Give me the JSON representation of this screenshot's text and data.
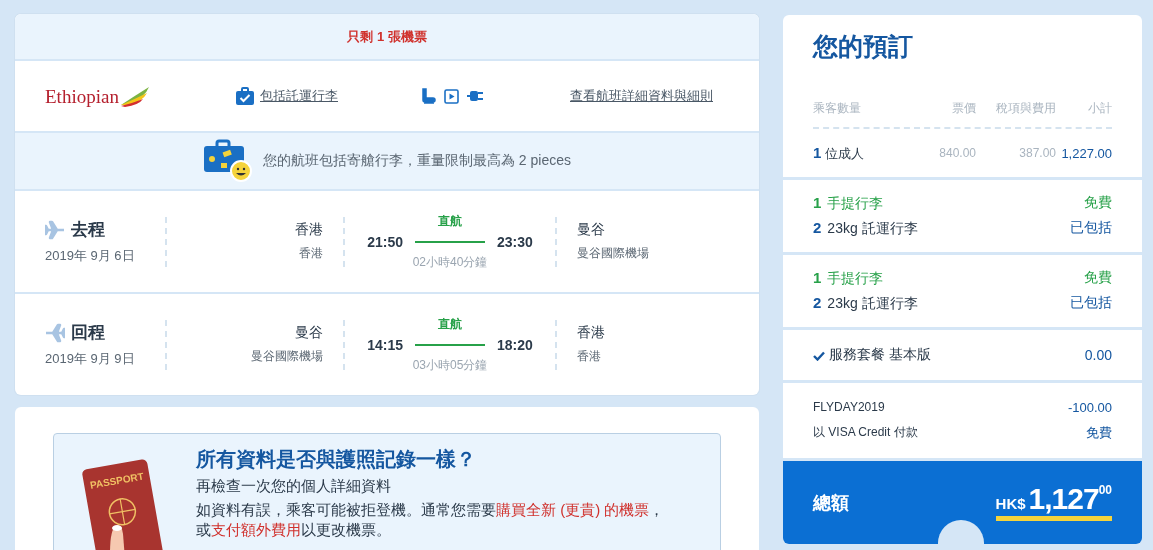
{
  "flight": {
    "notice": "只剩 1 張機票",
    "airline": {
      "name": "Ethiopian"
    },
    "baggage_link": "包括託運行李",
    "details_link": "查看航班詳細資料與細則",
    "baggage_note": "您的航班包括寄艙行李，重量限制最高為 2 pieces",
    "legs": [
      {
        "kind": "outbound",
        "label": "去程",
        "date": "2019年 9月 6日",
        "from_city": "香港",
        "from_airport": "香港",
        "depart": "21:50",
        "stops": "直航",
        "arrive": "23:30",
        "duration": "02小時40分鐘",
        "to_city": "曼谷",
        "to_airport": "曼谷國際機場"
      },
      {
        "kind": "return",
        "label": "回程",
        "date": "2019年 9月 9日",
        "from_city": "曼谷",
        "from_airport": "曼谷國際機場",
        "depart": "14:15",
        "stops": "直航",
        "arrive": "18:20",
        "duration": "03小時05分鐘",
        "to_city": "香港",
        "to_airport": "香港"
      }
    ]
  },
  "passport_check": {
    "passport_label": "PASSPORT",
    "title": "所有資料是否與護照記錄一樣？",
    "subtitle": "再檢查一次您的個人詳細資料",
    "body": [
      {
        "kind": "plain",
        "text": "如資料有誤，乘客可能被拒登機。通常您需要"
      },
      {
        "kind": "link",
        "text": "購買全新 (更貴) 的機票"
      },
      {
        "kind": "plain",
        "text": "，或"
      },
      {
        "kind": "link",
        "text": "支付額外費用"
      },
      {
        "kind": "plain",
        "text": "以更改機票。"
      }
    ]
  },
  "summary": {
    "title": "您的預訂",
    "columns": [
      "乘客數量",
      "票價",
      "稅項與費用",
      "小計"
    ],
    "passenger": {
      "count": "1",
      "label": "位成人",
      "fare": "840.00",
      "taxes": "387.00",
      "subtotal": "1,227.00"
    },
    "baggage_groups": [
      {
        "items": [
          {
            "kind": "carry_on",
            "count": "1",
            "label": "手提行李",
            "value": "免費"
          },
          {
            "kind": "checked",
            "count": "2",
            "label": "23kg 託運行李",
            "value": "已包括"
          }
        ]
      },
      {
        "items": [
          {
            "kind": "carry_on",
            "count": "1",
            "label": "手提行李",
            "value": "免費"
          },
          {
            "kind": "checked",
            "count": "2",
            "label": "23kg 託運行李",
            "value": "已包括"
          }
        ]
      }
    ],
    "service": {
      "label": "服務套餐 基本版",
      "value": "0.00"
    },
    "promo": {
      "code": "FLYDAY2019",
      "value": "-100.00"
    },
    "payment": {
      "label": "以 VISA Credit 付款",
      "value": "免費"
    },
    "total": {
      "label": "總額",
      "currency": "HK$",
      "amount": "1,127",
      "cents": "00"
    }
  }
}
